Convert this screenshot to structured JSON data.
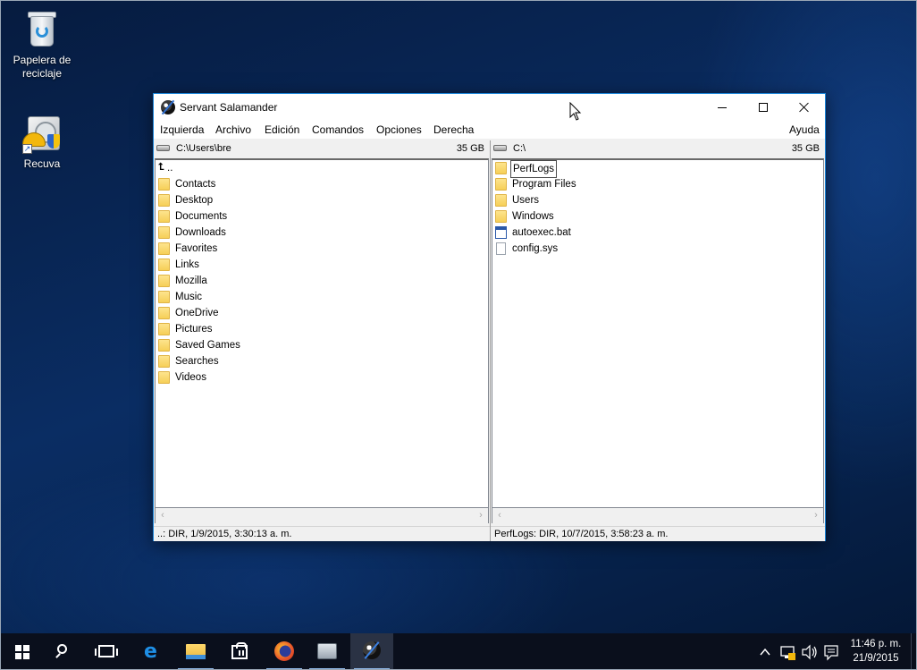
{
  "desktop": {
    "icons": [
      {
        "label_line1": "Papelera de",
        "label_line2": "reciclaje",
        "icon": "recycle-bin-icon"
      },
      {
        "label_line1": "Recuva",
        "label_line2": "",
        "icon": "recuva-icon"
      }
    ]
  },
  "window": {
    "title": "Servant Salamander",
    "menu": [
      "Izquierda",
      "Archivo",
      "Edición",
      "Comandos",
      "Opciones",
      "Derecha"
    ],
    "menu_help": "Ayuda"
  },
  "left_panel": {
    "path": "C:\\Users\\bre",
    "free_space": "35 GB",
    "up_label": "..",
    "items": [
      "Contacts",
      "Desktop",
      "Documents",
      "Downloads",
      "Favorites",
      "Links",
      "Mozilla",
      "Music",
      "OneDrive",
      "Pictures",
      "Saved Games",
      "Searches",
      "Videos"
    ],
    "status": "..: DIR, 1/9/2015, 3:30:13 a. m."
  },
  "right_panel": {
    "path": "C:\\",
    "free_space": "35 GB",
    "folders": [
      "PerfLogs",
      "Program Files",
      "Users",
      "Windows"
    ],
    "files": [
      {
        "name": "autoexec.bat",
        "icon": "batch-file-icon"
      },
      {
        "name": "config.sys",
        "icon": "document-icon"
      }
    ],
    "status": "PerfLogs: DIR, 10/7/2015, 3:58:23 a. m."
  },
  "taskbar": {
    "apps": [
      "start-icon",
      "search-icon",
      "task-view-icon",
      "edge-icon",
      "file-explorer-icon",
      "store-icon",
      "firefox-icon",
      "system-monitor-icon",
      "salamander-icon"
    ],
    "clock_time": "11:46 p. m.",
    "clock_date": "21/9/2015"
  }
}
